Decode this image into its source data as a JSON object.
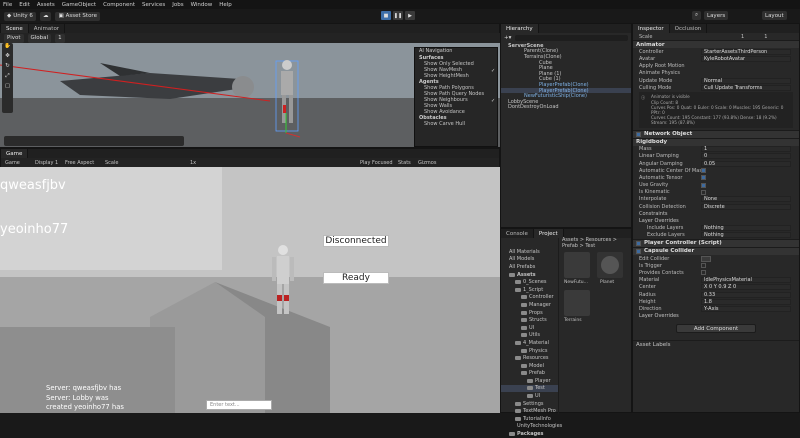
{
  "menu": [
    "File",
    "Edit",
    "Assets",
    "GameObject",
    "Component",
    "Services",
    "Jobs",
    "Window",
    "Help"
  ],
  "toolbar": {
    "account": "Unity 6",
    "asset_store": "Asset Store",
    "layers": "Layers",
    "layout": "Layout"
  },
  "scene_tabs": {
    "scene": "Scene",
    "animator": "Animator",
    "game": "Game"
  },
  "scene_toolbar": {
    "pivot": "Pivot",
    "global": "Global",
    "scale_val": "1"
  },
  "nav_overlay": {
    "title": "AI Navigation",
    "surfaces_label": "Surfaces",
    "surfaces": [
      "Show Only Selected",
      "Show NavMesh",
      "Show HeightMesh"
    ],
    "agents_label": "Agents",
    "agents": [
      "Show Path Polygons",
      "Show Path Query Nodes",
      "Show Neighbours",
      "Show Walls",
      "Show Avoidance"
    ],
    "obstacles_label": "Obstacles",
    "obstacles": [
      "Show Carve Hull"
    ]
  },
  "game_toolbar": {
    "mode": "Game",
    "display": "Display 1",
    "aspect": "Free Aspect",
    "scale_label": "Scale",
    "scale_val": "1x",
    "play_focused": "Play Focused",
    "stats": "Stats",
    "gizmos": "Gizmos"
  },
  "game": {
    "player1": "qweasfjbv",
    "player2": "yeoinho77",
    "disconnected": "Disconnected",
    "ready": "Ready",
    "chat_lines": [
      "Server: qweasfjbv has",
      "Server: Lobby was",
      "created yeoinho77 has"
    ],
    "chat_placeholder": "Enter text..."
  },
  "hierarchy": {
    "title": "Hierarchy",
    "items": [
      "ServerScene",
      "Parent(Clone)",
      "Terrains(Clone)",
      "Cube",
      "Plane",
      "Plane (1)",
      "Cube (1)",
      "PlayerPrefab(Clone)",
      "PlayerPrefab(Clone)",
      "NewFuturisticShip(Clone)",
      "LobbyScene",
      "DontDestroyOnLoad"
    ]
  },
  "inspector": {
    "tab": "Inspector",
    "tab2": "Occlusion",
    "scale": {
      "label": "Scale",
      "x": "1",
      "y": "1"
    },
    "animator": {
      "title": "Animator",
      "rows": [
        [
          "Controller",
          "StarterAssetsThirdPerson"
        ],
        [
          "Avatar",
          "KyleRobotAvatar"
        ],
        [
          "Apply Root Motion",
          ""
        ],
        [
          "Animate Physics",
          ""
        ],
        [
          "Update Mode",
          "Normal"
        ],
        [
          "Culling Mode",
          "Cull Update Transforms"
        ]
      ],
      "info": [
        "Animator is visible",
        "Clip Count: 8",
        "Curves Pos: 0 Quat: 0 Euler: 0 Scale: 0 Muscles: 195 Generic: 0 PPtr: 0",
        "Curves Count: 195 Constant: 177 (93.8%) Dense: 18 (9.2%)",
        "Stream: 195 (87.8%)"
      ]
    },
    "network_object": "Network Object",
    "rigidbody": {
      "title": "Rigidbody",
      "rows": [
        [
          "Mass",
          "1"
        ],
        [
          "Linear Damping",
          "0"
        ],
        [
          "Angular Damping",
          "0.05"
        ],
        [
          "Automatic Center Of Mass",
          ""
        ],
        [
          "Automatic Tensor",
          ""
        ],
        [
          "Use Gravity",
          ""
        ],
        [
          "Is Kinematic",
          ""
        ],
        [
          "Interpolate",
          "None"
        ],
        [
          "Collision Detection",
          "Discrete"
        ]
      ],
      "constraints": "Constraints",
      "layer_overrides": "Layer Overrides",
      "include": [
        "Include Layers",
        "Nothing"
      ],
      "exclude": [
        "Exclude Layers",
        "Nothing"
      ]
    },
    "player_controller": "Player Controller (Script)",
    "capsule": {
      "title": "Capsule Collider",
      "rows": [
        [
          "Edit Collider",
          ""
        ],
        [
          "Is Trigger",
          ""
        ],
        [
          "Provides Contacts",
          ""
        ],
        [
          "Material",
          "IdlePhysicsMaterial"
        ],
        [
          "Center",
          "X 0    Y 0.9    Z 0"
        ],
        [
          "Radius",
          "0.33"
        ],
        [
          "Height",
          "1.8"
        ],
        [
          "Direction",
          "Y-Axis"
        ]
      ],
      "layer_overrides": "Layer Overrides"
    },
    "add_component": "Add Component",
    "asset_labels": "Asset Labels"
  },
  "project": {
    "tabs": [
      "Console",
      "Project"
    ],
    "favorites": [
      "All Materials",
      "All Models",
      "All Prefabs"
    ],
    "breadcrumb": "Assets > Resources > Prefab > Test",
    "tree": [
      "Assets",
      "0_Scenes",
      "1_Script",
      "Controller",
      "Manager",
      "Props",
      "Structs",
      "UI",
      "Utils",
      "4_Material",
      "Physics",
      "Resources",
      "Model",
      "Prefab",
      "Player",
      "Test",
      "UI",
      "Settings",
      "TextMesh Pro",
      "TutorialInfo",
      "UnityTechnologies",
      "Packages"
    ],
    "assets": [
      "NewFutu...",
      "Planet",
      "Terrains"
    ]
  }
}
